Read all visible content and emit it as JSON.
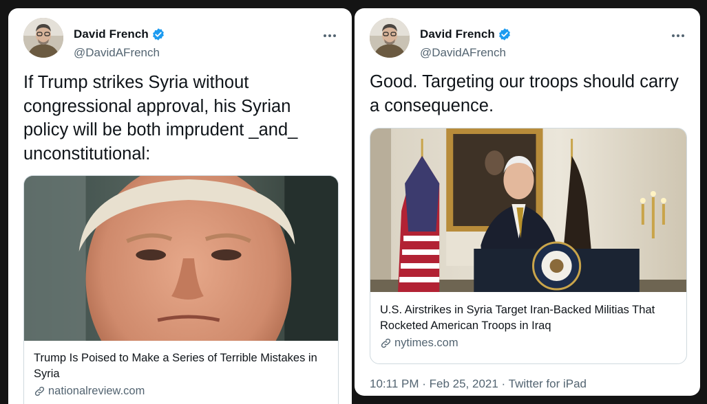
{
  "tweets": [
    {
      "author": {
        "name": "David French",
        "handle": "@DavidAFrench"
      },
      "text": "If Trump strikes Syria without congressional approval, his Syrian policy will be both imprudent _and_ unconstitutional:",
      "card": {
        "title": "Trump Is Poised to Make a Series of Terrible Mistakes in Syria",
        "domain": "nationalreview.com"
      }
    },
    {
      "author": {
        "name": "David French",
        "handle": "@DavidAFrench"
      },
      "text": "Good. Targeting our troops should carry a consequence.",
      "card": {
        "title": "U.S. Airstrikes in Syria Target Iran-Backed Militias That Rocketed American Troops in Iraq",
        "domain": "nytimes.com"
      },
      "meta": {
        "time": "10:11 PM",
        "date": "Feb 25, 2021",
        "source": "Twitter for iPad",
        "separator": " · "
      }
    }
  ],
  "icons": {
    "verified": "verified-badge-icon",
    "more": "more-options-icon",
    "link": "link-icon"
  },
  "colors": {
    "verified": "#1d9bf0",
    "text": "#0f1419",
    "secondary": "#536471",
    "border": "#cfd9de"
  }
}
